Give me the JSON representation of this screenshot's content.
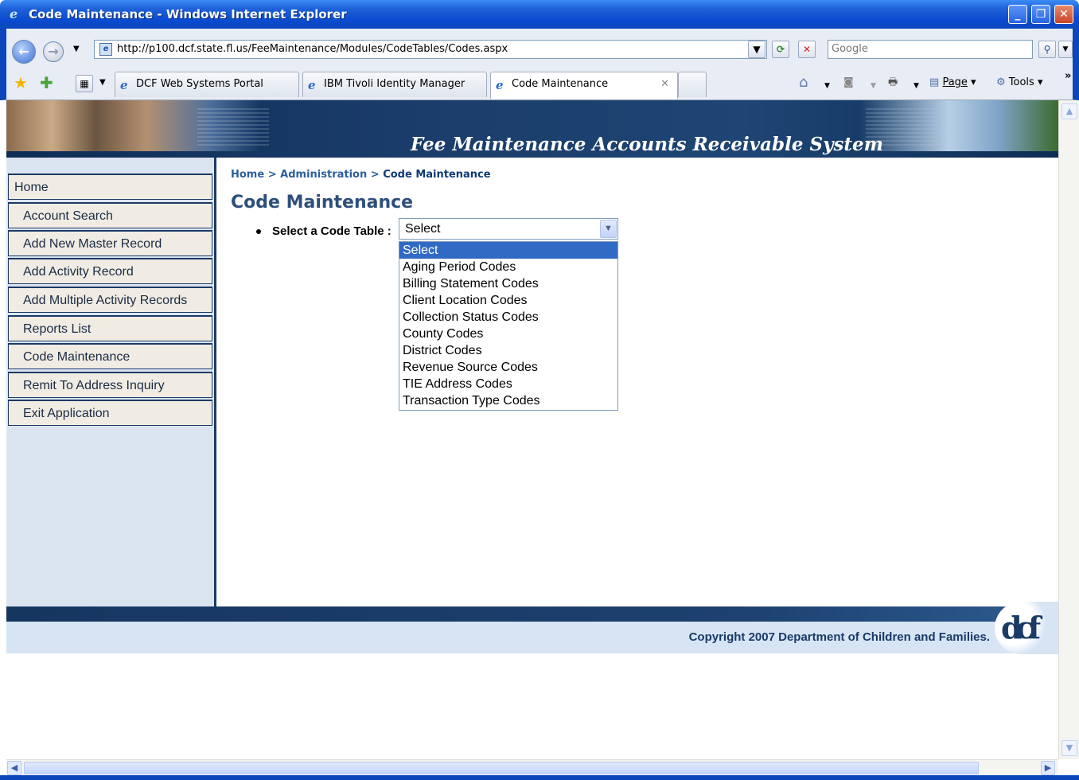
{
  "window": {
    "title": "Code Maintenance - Windows Internet Explorer"
  },
  "address_bar": {
    "url": "http://p100.dcf.state.fl.us/FeeMaintenance/Modules/CodeTables/Codes.aspx",
    "search_placeholder": "Google"
  },
  "tabs": [
    {
      "label": "DCF Web Systems Portal"
    },
    {
      "label": "IBM Tivoli Identity Manager"
    },
    {
      "label": "Code Maintenance",
      "active": true
    }
  ],
  "toolbar": {
    "page_label": "Page",
    "tools_label": "Tools"
  },
  "banner": {
    "system_title": "Fee Maintenance Accounts Receivable System"
  },
  "sidebar": {
    "items": [
      {
        "label": "Home"
      },
      {
        "label": "Account Search"
      },
      {
        "label": "Add New Master Record"
      },
      {
        "label": "Add Activity Record"
      },
      {
        "label": "Add Multiple Activity Records"
      },
      {
        "label": "Reports List"
      },
      {
        "label": "Code Maintenance"
      },
      {
        "label": "Remit To Address Inquiry"
      },
      {
        "label": "Exit Application"
      }
    ]
  },
  "breadcrumb": {
    "home": "Home",
    "sep": ">",
    "admin": "Administration",
    "current": "Code Maintenance"
  },
  "main": {
    "title": "Code Maintenance",
    "field_label": "Select a Code Table :",
    "selected_value": "Select",
    "options": [
      "Select",
      "Aging Period Codes",
      "Billing Statement Codes",
      "Client Location Codes",
      "Collection Status Codes",
      "County Codes",
      "District Codes",
      "Revenue Source Codes",
      "TIE Address Codes",
      "Transaction Type Codes"
    ]
  },
  "footer": {
    "copyright": "Copyright 2007 Department of Children and Families."
  },
  "colors": {
    "sidebar_bg": "#dbe5f1",
    "nav_item_bg": "#f0ece3",
    "accent": "#1b3b66",
    "selected_option": "#316ac5"
  },
  "icons": [
    "ie-icon",
    "minimize-icon",
    "maximize-icon",
    "close-icon",
    "back-arrow-icon",
    "forward-arrow-icon",
    "refresh-icon",
    "stop-icon",
    "search-icon",
    "favorites-star-icon",
    "add-favorite-icon",
    "home-icon",
    "feeds-icon",
    "print-icon",
    "page-icon",
    "tools-gear-icon",
    "chevron-down-icon"
  ]
}
